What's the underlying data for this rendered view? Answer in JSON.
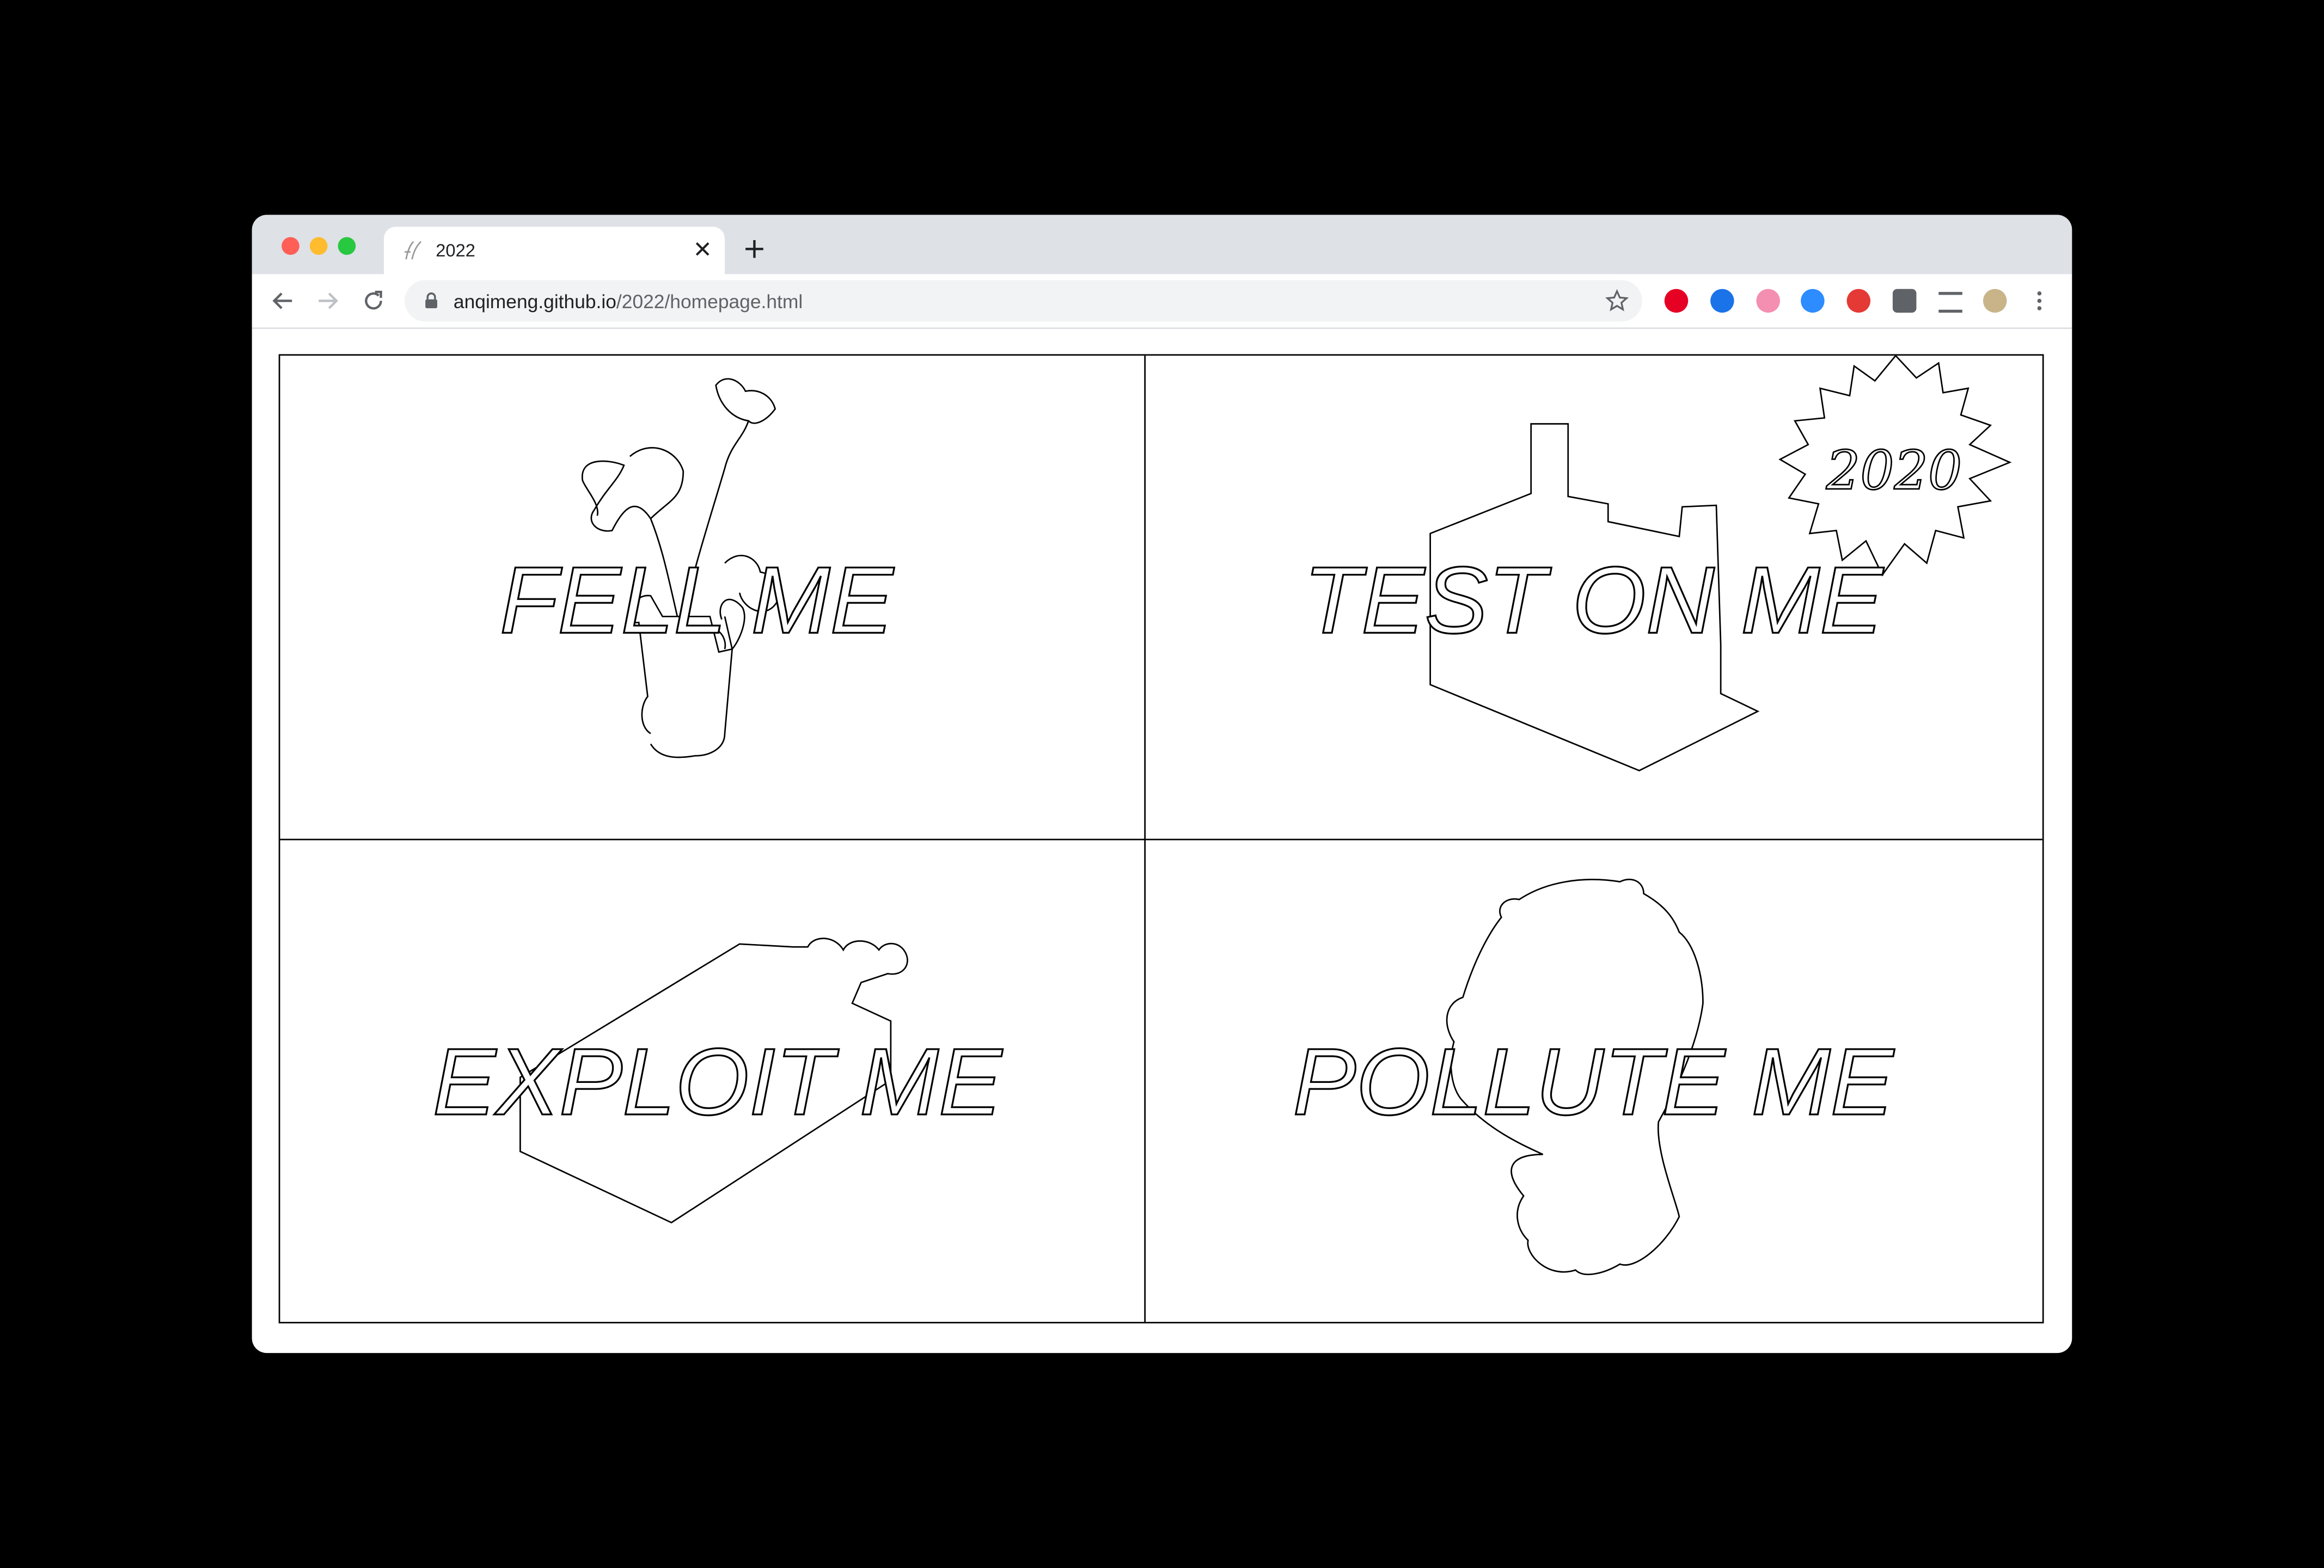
{
  "browser": {
    "tab_title": "2022",
    "url_domain": "anqimeng.github.io",
    "url_path": "/2022/homepage.html"
  },
  "extensions": [
    {
      "name": "pinterest-icon",
      "color": "#e60023"
    },
    {
      "name": "blue-extension-icon",
      "color": "#1a73e8"
    },
    {
      "name": "pink-extension-icon",
      "color": "#f48fb1"
    },
    {
      "name": "zoom-icon",
      "color": "#2d8cff"
    },
    {
      "name": "red-sync-icon",
      "color": "#e53935"
    },
    {
      "name": "puzzle-icon",
      "color": "#5f6368"
    },
    {
      "name": "media-queue-icon",
      "color": "#5f6368"
    },
    {
      "name": "profile-avatar",
      "color": "#c9b48a"
    }
  ],
  "panels": [
    {
      "id": "fell",
      "label": "FELL ME"
    },
    {
      "id": "test",
      "label": "TEST ON ME",
      "badge": "2020"
    },
    {
      "id": "exploit",
      "label": "EXPLOIT ME"
    },
    {
      "id": "pollute",
      "label": "POLLUTE ME"
    }
  ]
}
